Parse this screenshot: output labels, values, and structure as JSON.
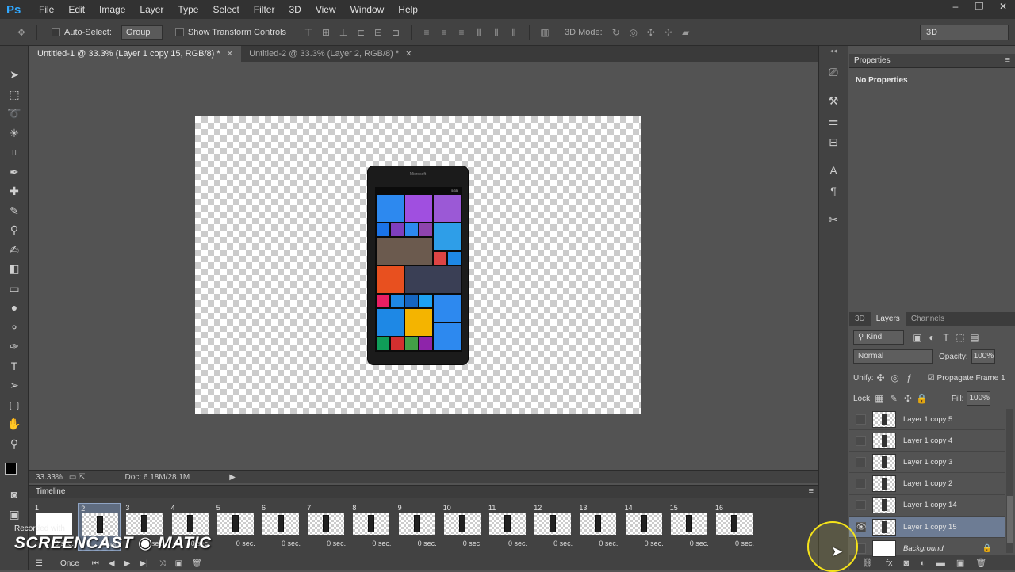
{
  "app": {
    "logo": "Ps"
  },
  "menu": [
    "File",
    "Edit",
    "Image",
    "Layer",
    "Type",
    "Select",
    "Filter",
    "3D",
    "View",
    "Window",
    "Help"
  ],
  "window_controls": [
    "–",
    "❐",
    "✕"
  ],
  "options_bar": {
    "auto_select_label": "Auto-Select:",
    "auto_select_value": "Group",
    "show_transform_label": "Show Transform Controls",
    "mode_3d_label": "3D Mode:",
    "workspace": "3D"
  },
  "tabs": [
    {
      "label": "Untitled-1 @ 33.3% (Layer 1 copy 15, RGB/8) *",
      "active": true
    },
    {
      "label": "Untitled-2 @ 33.3% (Layer 2, RGB/8) *",
      "active": false
    }
  ],
  "phone": {
    "brand": "Microsoft",
    "time": "5:35"
  },
  "status": {
    "zoom": "33.33%",
    "doc": "Doc: 6.18M/28.1M"
  },
  "timeline": {
    "title": "Timeline",
    "frames": [
      {
        "num": "1",
        "delay": "0 sec."
      },
      {
        "num": "2",
        "delay": "0 sec."
      },
      {
        "num": "3",
        "delay": "0 sec."
      },
      {
        "num": "4",
        "delay": "0 sec."
      },
      {
        "num": "5",
        "delay": "0 sec."
      },
      {
        "num": "6",
        "delay": "0 sec."
      },
      {
        "num": "7",
        "delay": "0 sec."
      },
      {
        "num": "8",
        "delay": "0 sec."
      },
      {
        "num": "9",
        "delay": "0 sec."
      },
      {
        "num": "10",
        "delay": "0 sec."
      },
      {
        "num": "11",
        "delay": "0 sec."
      },
      {
        "num": "12",
        "delay": "0 sec."
      },
      {
        "num": "13",
        "delay": "0 sec."
      },
      {
        "num": "14",
        "delay": "0 sec."
      },
      {
        "num": "15",
        "delay": "0 sec."
      },
      {
        "num": "16",
        "delay": "0 sec."
      }
    ],
    "loop": "Once"
  },
  "properties": {
    "title": "Properties",
    "body": "No Properties"
  },
  "layers_panel": {
    "tabs": [
      "3D",
      "Layers",
      "Channels"
    ],
    "kind": "Kind",
    "blend_mode": "Normal",
    "opacity_label": "Opacity:",
    "opacity_value": "100%",
    "unify_label": "Unify:",
    "propagate_label": "Propagate Frame 1",
    "lock_label": "Lock:",
    "fill_label": "Fill:",
    "fill_value": "100%",
    "layers": [
      {
        "name": "Layer 1 copy 5",
        "visible": false
      },
      {
        "name": "Layer 1 copy 4",
        "visible": false
      },
      {
        "name": "Layer 1 copy 3",
        "visible": false
      },
      {
        "name": "Layer 1 copy 2",
        "visible": false
      },
      {
        "name": "Layer 1 copy 14",
        "visible": false
      },
      {
        "name": "Layer 1 copy 15",
        "visible": true,
        "selected": true
      },
      {
        "name": "Background",
        "visible": false,
        "locked": true
      }
    ]
  },
  "watermark": {
    "top": "Recorded with",
    "main": "SCREENCAST ◉ MATIC"
  },
  "colors": {
    "accent": "#31a8ff",
    "selection": "#6d7c94",
    "cursor_ring": "#f5e31a"
  }
}
